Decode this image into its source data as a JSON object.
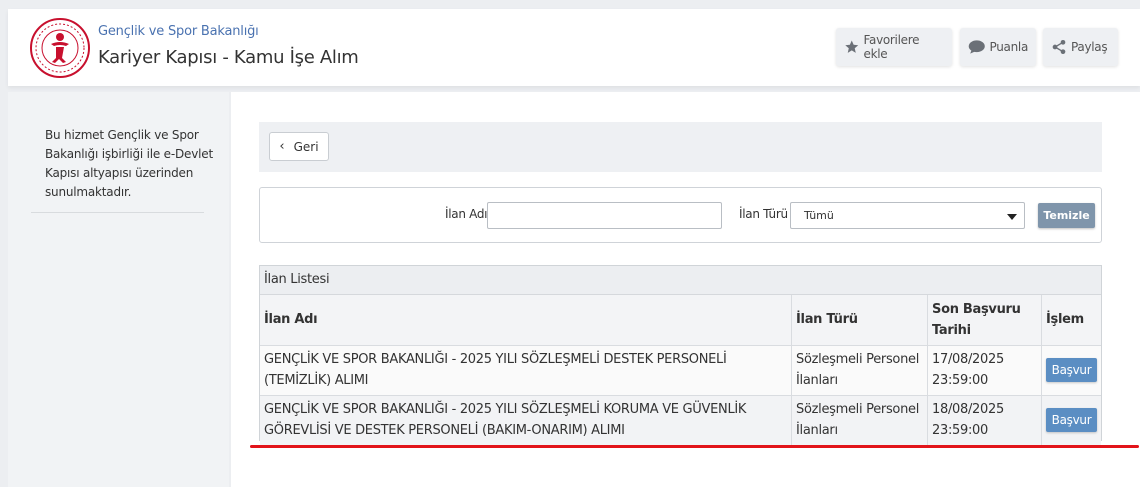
{
  "header": {
    "org_name": "Gençlik ve Spor Bakanlığı",
    "service_name": "Kariyer Kapısı - Kamu İşe Alım",
    "actions": {
      "favorite": "Favorilere ekle",
      "rate": "Puanla",
      "share": "Paylaş"
    }
  },
  "sidebar": {
    "info_text": "Bu hizmet Gençlik ve Spor Bakanlığı işbirliği ile e-Devlet Kapısı altyapısı üzerinden sunulmaktadır."
  },
  "main": {
    "back_label": "Geri",
    "filters": {
      "name_label": "İlan Adı",
      "name_value": "",
      "type_label": "İlan Türü",
      "type_selected": "Tümü",
      "clear_label": "Temizle"
    },
    "list": {
      "title": "İlan Listesi",
      "columns": [
        "İlan Adı",
        "İlan Türü",
        "Son Başvuru Tarihi",
        "İşlem"
      ],
      "rows": [
        {
          "name": "GENÇLİK VE SPOR BAKANLIĞI - 2025 YILI SÖZLEŞMELİ DESTEK PERSONELİ (TEMİZLİK) ALIMI",
          "type": "Sözleşmeli Personel İlanları",
          "deadline": "17/08/2025 23:59:00",
          "action": "Başvur"
        },
        {
          "name": "GENÇLİK VE SPOR BAKANLIĞI - 2025 YILI SÖZLEŞMELİ KORUMA VE GÜVENLİK GÖREVLİSİ VE DESTEK PERSONELİ (BAKIM-ONARIM) ALIMI",
          "type": "Sözleşmeli Personel İlanları",
          "deadline": "18/08/2025 23:59:00",
          "action": "Başvur"
        }
      ]
    }
  },
  "colors": {
    "accent": "#4a72b0",
    "apply_button": "#5b8ec3",
    "clear_button": "#7f95ab",
    "annotation_line": "#e2141a",
    "logo_red": "#c8102e"
  }
}
